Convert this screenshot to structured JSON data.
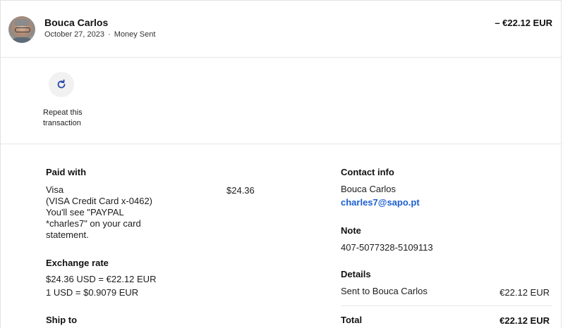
{
  "header": {
    "name": "Bouca Carlos",
    "date": "October 27, 2023",
    "separator": "·",
    "type": "Money Sent",
    "amount": "– €22.12 EUR"
  },
  "repeat": {
    "icon": "refresh-icon",
    "label_line1": "Repeat this",
    "label_line2": "transaction"
  },
  "paid_with": {
    "heading": "Paid with",
    "lines": [
      "Visa",
      "(VISA Credit Card x-0462)",
      "You'll see \"PAYPAL",
      "*charles7\" on your card",
      "statement."
    ],
    "amount": "$24.36"
  },
  "exchange": {
    "heading": "Exchange rate",
    "line1": "$24.36 USD = €22.12 EUR",
    "line2": "1 USD = $0.9079 EUR"
  },
  "ship_to": {
    "heading": "Ship to"
  },
  "contact": {
    "heading": "Contact info",
    "name": "Bouca Carlos",
    "email": "charles7@sapo.pt"
  },
  "note": {
    "heading": "Note",
    "value": "407-5077328-5109113"
  },
  "details": {
    "heading": "Details",
    "sent_to": "Sent to Bouca Carlos",
    "sent_amount": "€22.12 EUR"
  },
  "total": {
    "label": "Total",
    "amount": "€22.12 EUR"
  },
  "colors": {
    "link": "#1b5fd1",
    "icon": "#2c4aa8"
  }
}
